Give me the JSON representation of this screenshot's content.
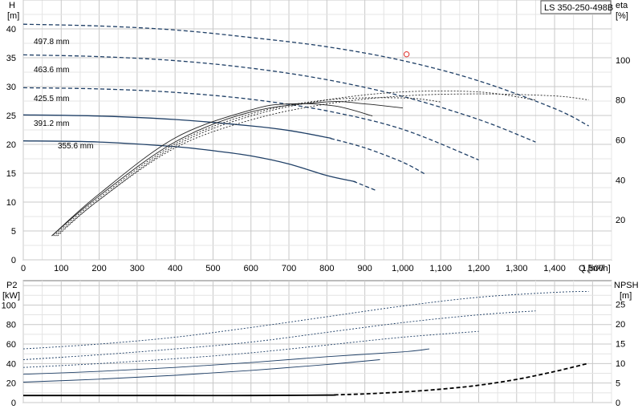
{
  "chart_data": [
    {
      "type": "line",
      "title": "LS 350-250-498B",
      "xlabel": "Q [m³/h]",
      "ylabel": "H [m]",
      "y2label": "eta [%]",
      "xlim": [
        0,
        1550
      ],
      "ylim": [
        0,
        45
      ],
      "y2lim": [
        0,
        130
      ],
      "x_ticks": [
        "0",
        "100",
        "200",
        "300",
        "400",
        "500",
        "600",
        "700",
        "800",
        "900",
        "1,000",
        "1,100",
        "1,200",
        "1,300",
        "1,400",
        "1,500"
      ],
      "x_tick_values": [
        0,
        100,
        200,
        300,
        400,
        500,
        600,
        700,
        800,
        900,
        1000,
        1100,
        1200,
        1300,
        1400,
        1500
      ],
      "y_ticks": [
        0,
        5,
        10,
        15,
        20,
        25,
        30,
        35,
        40
      ],
      "y2_ticks": [
        20,
        40,
        60,
        80,
        100
      ],
      "grid": true,
      "duty_point": {
        "x": 1010,
        "y": 35.6
      },
      "head_curves": [
        {
          "name": "497.8 mm",
          "color": "#1f3f66",
          "dashed": true,
          "x": [
            0,
            200,
            400,
            600,
            800,
            1000,
            1200,
            1400,
            1490
          ],
          "y": [
            40.8,
            40.5,
            39.8,
            38.5,
            36.9,
            34.5,
            31.0,
            26.2,
            23.2
          ]
        },
        {
          "name": "463.6 mm",
          "color": "#1f3f66",
          "dashed": true,
          "x": [
            0,
            200,
            400,
            600,
            800,
            1000,
            1200,
            1350
          ],
          "y": [
            35.5,
            35.2,
            34.5,
            33.2,
            31.2,
            28.3,
            24.3,
            20.4
          ]
        },
        {
          "name": "425.5 mm",
          "color": "#1f3f66",
          "dashed": true,
          "x": [
            0,
            200,
            400,
            600,
            800,
            1000,
            1200
          ],
          "y": [
            29.8,
            29.6,
            29.0,
            27.8,
            25.8,
            22.6,
            17.3
          ]
        },
        {
          "name": "391.2 mm",
          "color": "#1f3f66",
          "solid_until": 810,
          "x": [
            0,
            200,
            400,
            600,
            700,
            800,
            900,
            1000,
            1060
          ],
          "y": [
            25.1,
            24.9,
            24.3,
            23.2,
            22.4,
            21.2,
            19.4,
            16.9,
            14.8
          ]
        },
        {
          "name": "355.6 mm",
          "color": "#1f3f66",
          "solid_until": 870,
          "x": [
            0,
            200,
            400,
            500,
            600,
            700,
            800,
            870,
            930
          ],
          "y": [
            20.6,
            20.4,
            19.6,
            18.9,
            18.0,
            16.6,
            14.6,
            13.6,
            12.0
          ]
        }
      ],
      "eta_curves": [
        {
          "name": "497.8 mm",
          "dashed": true,
          "x": [
            90,
            200,
            400,
            600,
            800,
            1000,
            1200,
            1400,
            1490
          ],
          "y": [
            12,
            30,
            56,
            70,
            78,
            82,
            83,
            82,
            80
          ]
        },
        {
          "name": "463.6 mm",
          "dashed": true,
          "x": [
            85,
            200,
            400,
            600,
            800,
            1000,
            1200,
            1350
          ],
          "y": [
            12,
            30,
            57,
            72,
            80,
            84,
            84,
            80
          ]
        },
        {
          "name": "425.5 mm",
          "dashed": true,
          "x": [
            80,
            200,
            400,
            600,
            800,
            1000,
            1100
          ],
          "y": [
            12,
            31,
            58,
            73,
            80,
            81,
            79
          ]
        },
        {
          "name": "391.2 mm",
          "dashed": false,
          "x": [
            75,
            200,
            400,
            600,
            800,
            900,
            1000
          ],
          "y": [
            12,
            32,
            59,
            74,
            79,
            78,
            76
          ]
        },
        {
          "name": "355.6 mm",
          "dashed": false,
          "x": [
            75,
            200,
            400,
            600,
            700,
            820,
            920
          ],
          "y": [
            12,
            33,
            61,
            75,
            78,
            77,
            72
          ]
        }
      ]
    },
    {
      "type": "line",
      "ylabel": "P2 [kW]",
      "y2label": "NPSH [m]",
      "xlim": [
        0,
        1550
      ],
      "ylim": [
        0,
        125
      ],
      "y2lim": [
        0,
        31
      ],
      "y_ticks": [
        0,
        20,
        40,
        60,
        80,
        100
      ],
      "y2_ticks": [
        0,
        5,
        10,
        15,
        20,
        25
      ],
      "grid": true,
      "power_curves": [
        {
          "name": "497.8 mm",
          "dashed": true,
          "x": [
            0,
            200,
            400,
            600,
            800,
            1000,
            1200,
            1400,
            1490
          ],
          "y": [
            55,
            60,
            67,
            77,
            88,
            99,
            108,
            113,
            114
          ]
        },
        {
          "name": "463.6 mm",
          "dashed": true,
          "x": [
            0,
            200,
            400,
            600,
            800,
            1000,
            1200,
            1350
          ],
          "y": [
            44,
            49,
            55,
            62,
            72,
            82,
            90,
            94
          ]
        },
        {
          "name": "425.5 mm",
          "dashed": true,
          "x": [
            0,
            200,
            400,
            600,
            800,
            1000,
            1200
          ],
          "y": [
            36,
            40,
            45,
            51,
            59,
            67,
            73
          ]
        },
        {
          "name": "391.2 mm",
          "dashed": false,
          "x": [
            0,
            200,
            400,
            600,
            800,
            1000,
            1070
          ],
          "y": [
            29,
            32,
            36,
            41,
            47,
            52,
            55
          ]
        },
        {
          "name": "355.6 mm",
          "dashed": false,
          "x": [
            0,
            200,
            400,
            600,
            800,
            940
          ],
          "y": [
            21,
            24,
            28,
            33,
            39,
            44
          ]
        }
      ],
      "npsh_curve": {
        "dashed_from": 820,
        "x": [
          0,
          200,
          400,
          600,
          800,
          900,
          1000,
          1100,
          1200,
          1300,
          1400,
          1490
        ],
        "y": [
          1.8,
          1.8,
          1.8,
          1.8,
          1.9,
          2.2,
          2.7,
          3.4,
          4.4,
          5.9,
          7.9,
          10.0
        ]
      }
    }
  ],
  "curve_labels": [
    "497.8 mm",
    "463.6 mm",
    "425.5 mm",
    "391.2 mm",
    "355.6 mm"
  ],
  "top": {
    "hlabel": "H",
    "hunit": "[m]",
    "etalabel": "eta",
    "etaunit": "[%]",
    "qlabel": "Q [m³/h]",
    "title": "LS 350-250-498B"
  },
  "bottom": {
    "p2label": "P2",
    "p2unit": "[kW]",
    "npshlabel": "NPSH",
    "npshunit": "[m]"
  }
}
